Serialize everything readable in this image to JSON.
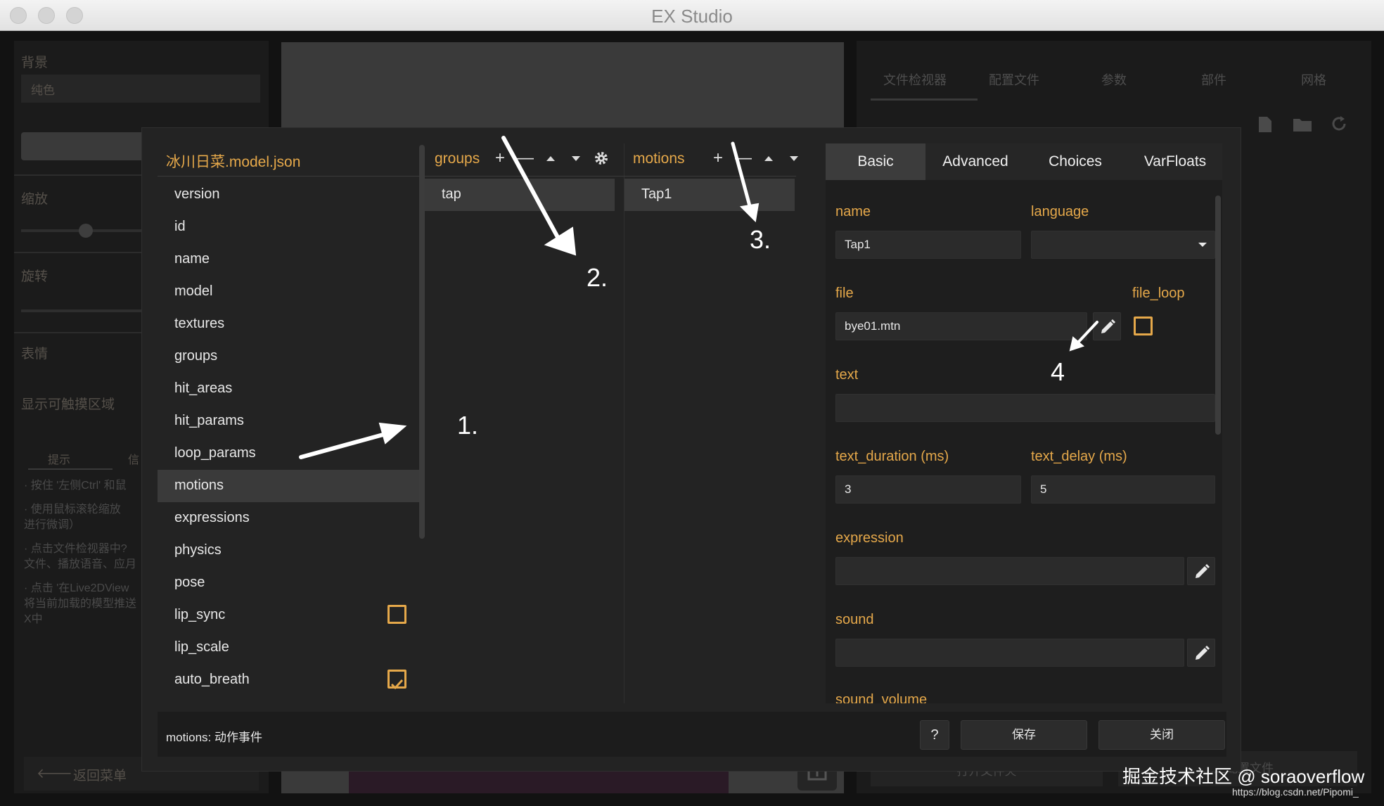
{
  "window": {
    "title": "EX Studio"
  },
  "background": {
    "left": {
      "section_background": "背景",
      "background_select": "纯色",
      "section_scale": "缩放",
      "section_rotate": "旋转",
      "section_expression": "表情",
      "section_touch": "显示可触摸区域",
      "tabs": [
        "提示",
        "信"
      ],
      "tips": [
        "· 按住 '左侧Ctrl' 和鼠",
        "· 使用鼠标滚轮缩放",
        "进行微调）",
        "· 点击文件检视器中?",
        "文件、播放语音、应月",
        "· 点击 '在Live2DView",
        "将当前加载的模型推送",
        "X中"
      ],
      "back_menu": "返回菜单"
    },
    "right": {
      "tabs": [
        "文件检视器",
        "配置文件",
        "参数",
        "部件",
        "网格"
      ],
      "open_folder": "打开文件夹",
      "create_config": "创建配置文件"
    }
  },
  "dialog": {
    "file_header": "冰川日菜.model.json",
    "keys": [
      {
        "label": "version"
      },
      {
        "label": "id"
      },
      {
        "label": "name"
      },
      {
        "label": "model"
      },
      {
        "label": "textures"
      },
      {
        "label": "groups"
      },
      {
        "label": "hit_areas"
      },
      {
        "label": "hit_params"
      },
      {
        "label": "loop_params"
      },
      {
        "label": "motions",
        "selected": true
      },
      {
        "label": "expressions"
      },
      {
        "label": "physics"
      },
      {
        "label": "pose"
      },
      {
        "label": "lip_sync",
        "checkbox": true,
        "checked": false
      },
      {
        "label": "lip_scale"
      },
      {
        "label": "auto_breath",
        "checkbox": true,
        "checked": true
      }
    ],
    "groups": {
      "header": "groups",
      "items": [
        "tap"
      ]
    },
    "motions": {
      "header": "motions",
      "items": [
        "Tap1"
      ]
    },
    "tabs": [
      "Basic",
      "Advanced",
      "Choices",
      "VarFloats"
    ],
    "active_tab": "Basic",
    "fields": {
      "name_label": "name",
      "name_value": "Tap1",
      "language_label": "language",
      "language_value": "",
      "file_label": "file",
      "file_value": "bye01.mtn",
      "file_loop_label": "file_loop",
      "file_loop_checked": false,
      "text_label": "text",
      "text_value": "",
      "text_duration_label": "text_duration (ms)",
      "text_duration_value": "3",
      "text_delay_label": "text_delay (ms)",
      "text_delay_value": "5",
      "expression_label": "expression",
      "expression_value": "",
      "sound_label": "sound",
      "sound_value": "",
      "sound_volume_label": "sound_volume"
    },
    "status": "motions: 动作事件",
    "buttons": {
      "help": "?",
      "save": "保存",
      "close": "关闭"
    }
  },
  "annotations": [
    "1.",
    "2.",
    "3.",
    "4"
  ],
  "watermark": {
    "main": "掘金技术社区 @ soraoverflow",
    "url": "https://blog.csdn.net/Pipomi_"
  },
  "colors": {
    "accent": "#e5a84a",
    "selected_row": "#3a3a3a",
    "dialog_bg": "#232323"
  }
}
